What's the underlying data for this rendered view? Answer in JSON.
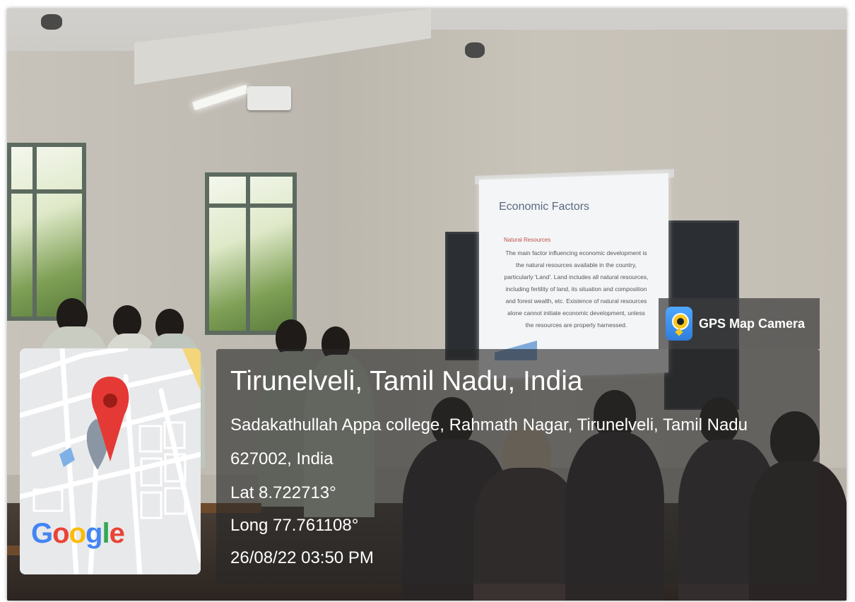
{
  "slide": {
    "title": "Economic Factors",
    "bullet": "Natural Resources",
    "text": "The main factor influencing economic development is the natural resources available in the country, particularly 'Land'. Land includes all natural resources, including fertility of land, its situation and composition and forest wealth, etc. Existence of natural resources alone cannot initiate economic development, unless the resources are properly harnessed."
  },
  "gps_tag": {
    "app_name": "GPS Map Camera",
    "icon": "gps-map-camera-icon"
  },
  "location": {
    "city": "Tirunelveli, Tamil Nadu, India",
    "address_line1": "Sadakathullah Appa college, Rahmath Nagar, Tirunelveli, Tamil Nadu",
    "address_line2": "627002, India",
    "lat": "Lat 8.722713°",
    "long": "Long 77.761108°",
    "datetime": "26/08/22 03:50 PM"
  },
  "map": {
    "brand": "Google",
    "pin_color": "#e53935"
  }
}
